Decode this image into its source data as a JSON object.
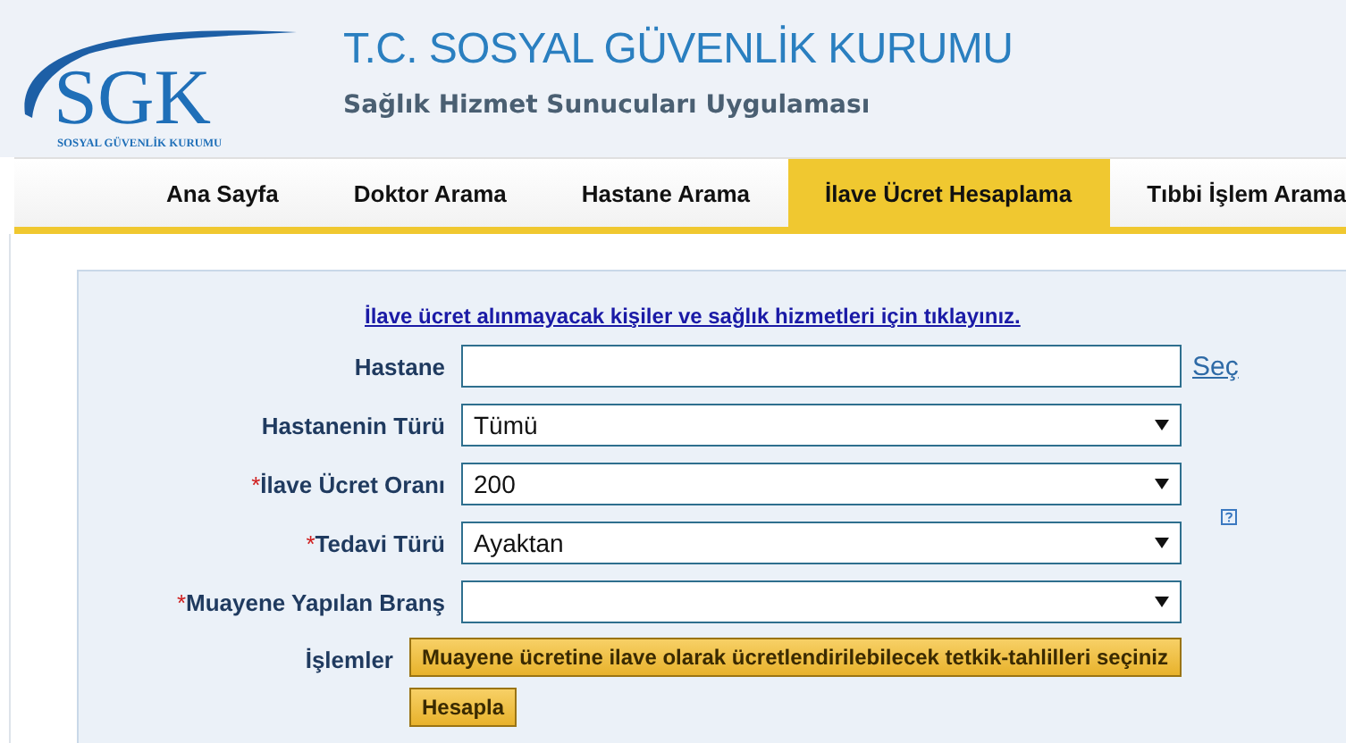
{
  "logo": {
    "letters": "SGK",
    "caption": "SOSYAL GÜVENLİK KURUMU"
  },
  "header": {
    "title": "T.C. SOSYAL GÜVENLİK KURUMU",
    "subtitle": "Sağlık Hizmet Sunucuları Uygulaması"
  },
  "nav": [
    {
      "label": "Ana Sayfa",
      "selected": false
    },
    {
      "label": "Doktor Arama",
      "selected": false
    },
    {
      "label": "Hastane Arama",
      "selected": false
    },
    {
      "label": "İlave Ücret Hesaplama",
      "selected": true
    },
    {
      "label": "Tıbbi İşlem Arama",
      "selected": false
    }
  ],
  "form": {
    "info_link": "İlave ücret alınmayacak kişiler ve sağlık hizmetleri için tıklayınız.",
    "fields": [
      {
        "label": "Hastane",
        "kind": "text",
        "link": "Seç"
      },
      {
        "label": "Hastanenin Türü",
        "kind": "select",
        "value": "Tümü"
      },
      {
        "required_mark": "*",
        "label": "İlave Ücret Oranı",
        "kind": "select",
        "value": "200"
      },
      {
        "required_mark": "*",
        "label": "Tedavi Türü",
        "kind": "select",
        "value": "Ayaktan",
        "help": true
      },
      {
        "required_mark": "*",
        "label": "Muayene Yapılan Branş",
        "kind": "select"
      }
    ],
    "actions_label": "İşlemler",
    "buttons": [
      "Muayene ücretine ilave olarak ücretlendirilebilecek tetkik-tahlilleri seçiniz",
      "Hesapla"
    ]
  }
}
